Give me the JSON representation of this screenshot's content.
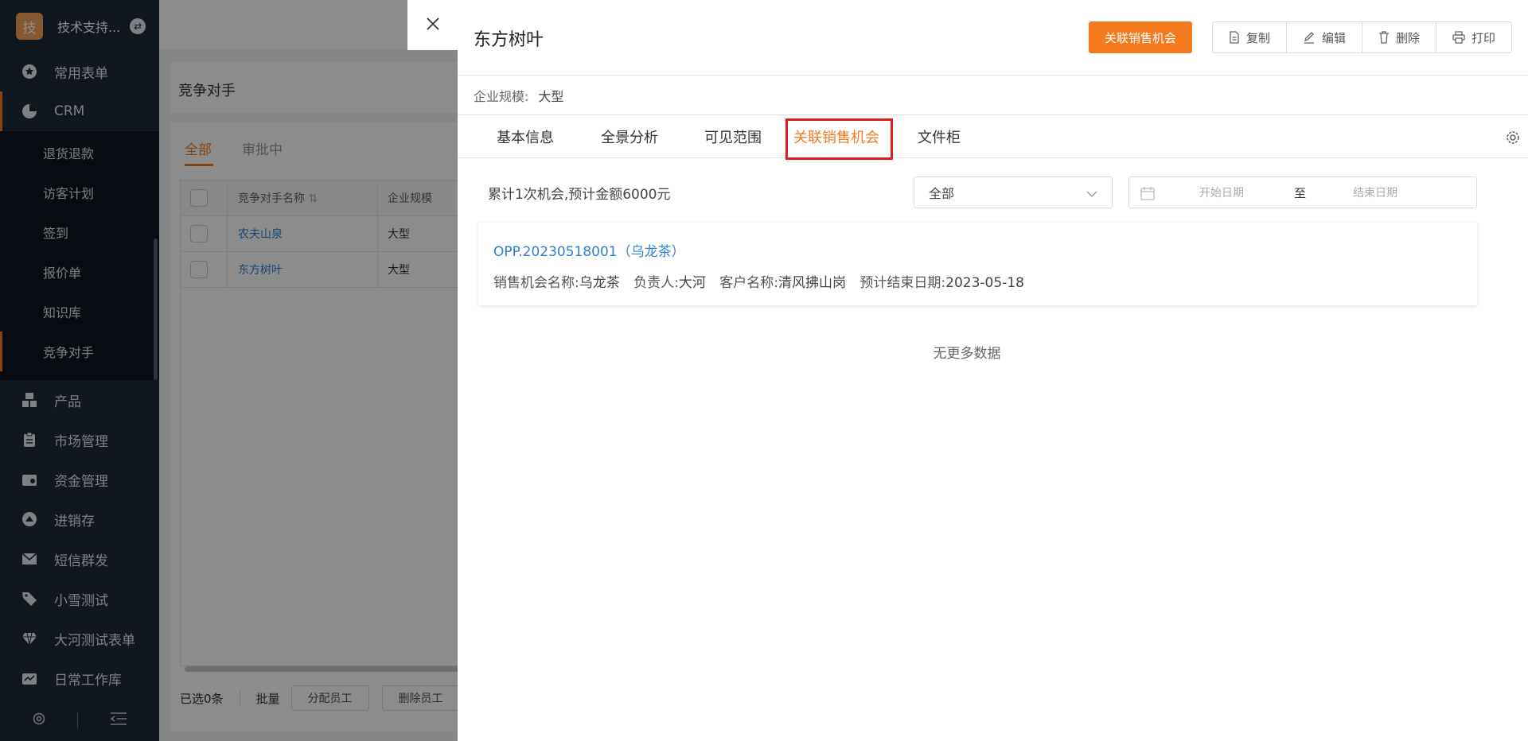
{
  "sidebar": {
    "logo_char": "技",
    "org_name": "技术支持...",
    "org_badge": "⇄",
    "menu": [
      {
        "label": "常用表单",
        "icon": "star-icon"
      },
      {
        "label": "CRM",
        "icon": "pie-chart-icon"
      }
    ],
    "crm_sub": [
      "退货退款",
      "访客计划",
      "签到",
      "报价单",
      "知识库",
      "竞争对手"
    ],
    "menu_after": [
      {
        "label": "产品",
        "icon": "boxes-icon"
      },
      {
        "label": "市场管理",
        "icon": "clipboard-icon"
      },
      {
        "label": "资金管理",
        "icon": "wallet-icon"
      },
      {
        "label": "进销存",
        "icon": "inventory-icon"
      },
      {
        "label": "短信群发",
        "icon": "mail-icon"
      },
      {
        "label": "小雪测试",
        "icon": "tag-icon"
      },
      {
        "label": "大河测试表单",
        "icon": "diamond-icon"
      },
      {
        "label": "日常工作库",
        "icon": "work-icon"
      }
    ]
  },
  "bg_page": {
    "title": "竞争对手",
    "tabs": [
      "全部",
      "审批中"
    ],
    "columns": [
      "竞争对手名称",
      "企业规模"
    ],
    "rows": [
      {
        "name": "农夫山泉",
        "size": "大型"
      },
      {
        "name": "东方树叶",
        "size": "大型"
      }
    ],
    "selected_text": "已选0条",
    "batch_label": "批量",
    "assign_btn": "分配员工",
    "remove_btn": "删除员工"
  },
  "drawer": {
    "title": "东方树叶",
    "primary_button": "关联销售机会",
    "actions": [
      {
        "label": "复制",
        "icon": "copy-icon"
      },
      {
        "label": "编辑",
        "icon": "edit-icon"
      },
      {
        "label": "删除",
        "icon": "trash-icon"
      },
      {
        "label": "打印",
        "icon": "print-icon"
      }
    ],
    "field_label": "企业规模:",
    "field_value": "大型",
    "tabs": [
      "基本信息",
      "全景分析",
      "可见范围",
      "关联销售机会",
      "文件柜"
    ],
    "active_tab": "关联销售机会",
    "summary": "累计1次机会,预计金额6000元",
    "filter_value": "全部",
    "date_start_placeholder": "开始日期",
    "date_to": "至",
    "date_end_placeholder": "结束日期",
    "opportunity": {
      "id": "OPP.20230518001（乌龙茶）",
      "name_label": "销售机会名称:",
      "name": "乌龙茶",
      "owner_label": "负责人:",
      "owner": "大河",
      "customer_label": "客户名称:",
      "customer": "清风拂山岗",
      "end_label": "预计结束日期:",
      "end_date": "2023-05-18"
    },
    "no_more": "无更多数据"
  },
  "colors": {
    "accent": "#f57a1f",
    "link": "#2f7fd4",
    "highlight": "#e31b1b",
    "sidebar_bg": "#1e2a3a"
  }
}
